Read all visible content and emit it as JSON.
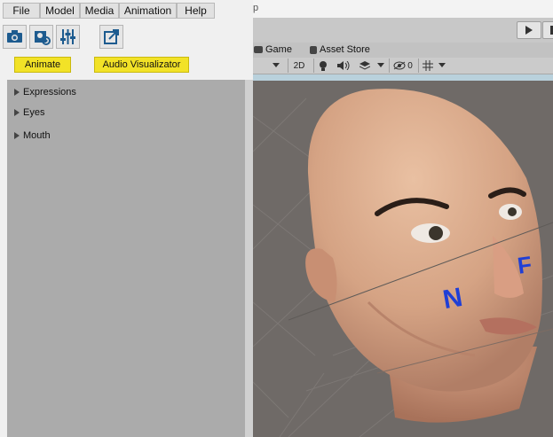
{
  "tool_window": {
    "menu": [
      "File",
      "Model",
      "Media",
      "Animation",
      "Help"
    ],
    "icon_buttons": [
      "camera-icon",
      "settings-photo-icon",
      "sliders-icon",
      "export-icon"
    ],
    "buttons": {
      "animate": "Animate",
      "audio_visualizer": "Audio Visualizator"
    },
    "tree": [
      "Expressions",
      "Eyes",
      "Mouth"
    ]
  },
  "unity": {
    "title_fragment": "p",
    "tabs": {
      "game": "Game",
      "asset_store": "Asset Store"
    },
    "toolbar": {
      "mode_2d": "2D",
      "hidden_count": "0"
    },
    "overlay_letters": {
      "left": "N",
      "right": "F"
    },
    "accent_blue": "#1f3fd6",
    "highlight_yellow": "#f2e227"
  }
}
